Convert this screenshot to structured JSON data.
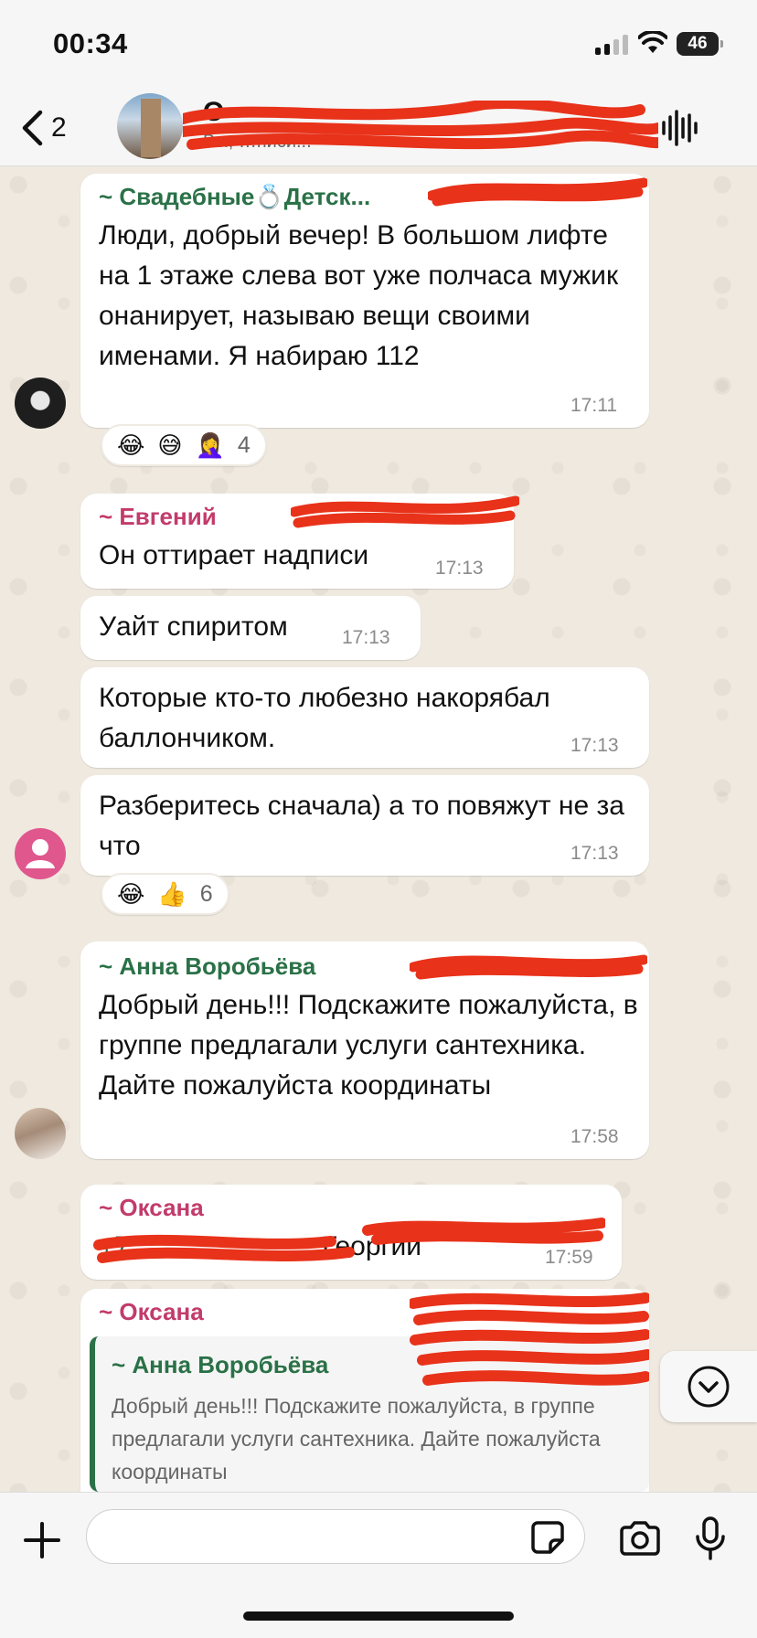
{
  "status_bar": {
    "time": "00:34",
    "battery": "46"
  },
  "header": {
    "back_count": "2",
    "group_title": "О",
    "group_subtitle": "Вы, …писи..."
  },
  "messages": [
    {
      "sender": "~ Свадебные💍Детск...",
      "text": "Люди, добрый вечер! В большом лифте на 1 этаже слева вот уже полчаса мужик онанирует, называю вещи своими именами.  Я набираю 112",
      "time": "17:11",
      "reactions": [
        "😂",
        "😅",
        "🤦‍♀️"
      ],
      "reaction_count": "4"
    },
    {
      "sender": "~ Евгений",
      "text": "Он оттирает надписи",
      "time": "17:13"
    },
    {
      "text": "Уайт спиритом",
      "time": "17:13"
    },
    {
      "text": "Которые кто-то любезно накорябал баллончиком.",
      "time": "17:13"
    },
    {
      "text": "Разберитесь сначала) а то повяжут не за что",
      "time": "17:13",
      "reactions": [
        "😂",
        "👍"
      ],
      "reaction_count": "6"
    },
    {
      "sender": "~ Анна Воробьёва",
      "text": "Добрый день!!! Подскажите пожалуйста, в группе предлагали услуги сантехника. Дайте пожалуйста координаты",
      "time": "17:58"
    },
    {
      "sender": "~ Оксана",
      "link": "+7",
      "text": "Георгий",
      "time": "17:59"
    },
    {
      "sender": "~ Оксана",
      "quote": {
        "sender": "~ Анна Воробьёва",
        "text": "Добрый день!!! Подскажите пожалуйста, в группе предлагали услуги сантехника. Дайте пожалуйста координаты"
      }
    }
  ],
  "input": {
    "placeholder": ""
  },
  "colors": {
    "accent_green": "#2a7147",
    "sender_pink": "#c23b6b",
    "redaction_red": "#e8321a",
    "bubble": "#ffffff",
    "background": "#efeae2"
  },
  "icons": [
    "back-chevron-icon",
    "waveform-icon",
    "chevron-down-icon",
    "plus-icon",
    "sticker-icon",
    "camera-icon",
    "mic-icon"
  ]
}
